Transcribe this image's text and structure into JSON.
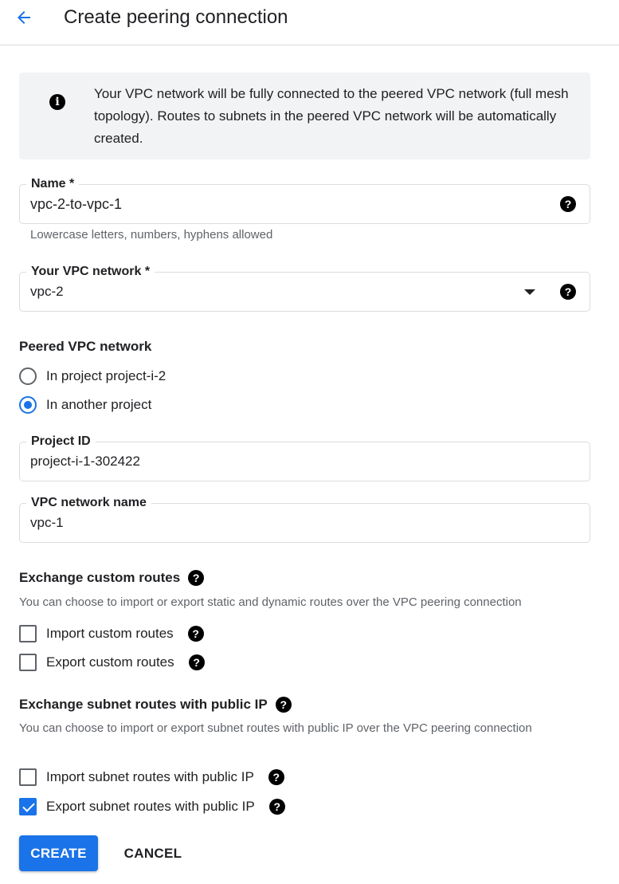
{
  "header": {
    "title": "Create peering connection",
    "back_icon": "arrow-back-icon"
  },
  "banner": {
    "icon": "info-icon",
    "text": "Your VPC network will be fully connected to the peered VPC network (full mesh topology). Routes to subnets in the peered VPC network will be automatically created."
  },
  "name_field": {
    "label": "Name *",
    "value": "vpc-2-to-vpc-1",
    "hint": "Lowercase letters, numbers, hyphens allowed"
  },
  "vpc_field": {
    "label": "Your VPC network *",
    "value": "vpc-2"
  },
  "peered": {
    "title": "Peered VPC network",
    "options": [
      {
        "label": "In project project-i-2",
        "checked": false
      },
      {
        "label": "In another project",
        "checked": true
      }
    ]
  },
  "project_field": {
    "label": "Project ID",
    "value": "project-i-1-302422"
  },
  "vpc_name_field": {
    "label": "VPC network name",
    "value": "vpc-1"
  },
  "custom_routes": {
    "title": "Exchange custom routes",
    "desc": "You can choose to import or export static and dynamic routes over the VPC peering connection",
    "options": [
      {
        "label": "Import custom routes",
        "checked": false
      },
      {
        "label": "Export custom routes",
        "checked": false
      }
    ]
  },
  "subnet_routes": {
    "title": "Exchange subnet routes with public IP",
    "desc": "You can choose to import or export subnet routes with public IP over the VPC peering connection",
    "options": [
      {
        "label": "Import subnet routes with public IP",
        "checked": false
      },
      {
        "label": "Export subnet routes with public IP",
        "checked": true
      }
    ]
  },
  "help_glyph": "?",
  "info_glyph": "i",
  "actions": {
    "create": "CREATE",
    "cancel": "CANCEL"
  },
  "colors": {
    "primary": "#1a73e8",
    "banner_bg": "#f1f3f4",
    "border": "#dadce0",
    "hint": "#5f6368"
  }
}
